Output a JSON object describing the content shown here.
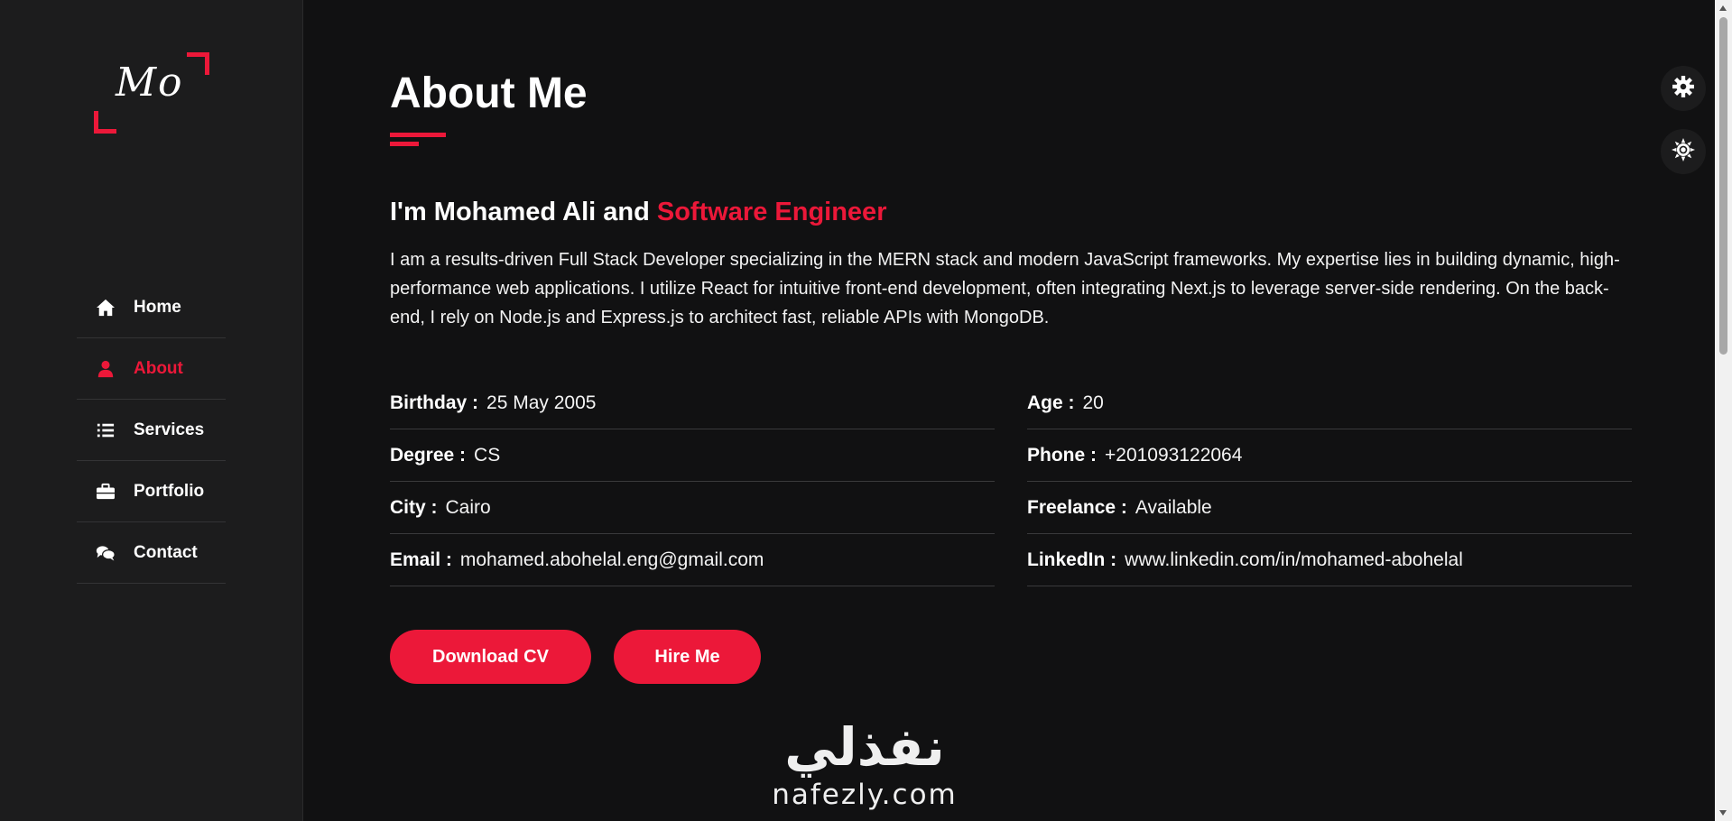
{
  "logo": {
    "text": "Mo"
  },
  "nav": [
    {
      "label": "Home",
      "icon": "home-icon"
    },
    {
      "label": "About",
      "icon": "user-icon",
      "active": true
    },
    {
      "label": "Services",
      "icon": "list-icon"
    },
    {
      "label": "Portfolio",
      "icon": "briefcase-icon"
    },
    {
      "label": "Contact",
      "icon": "comments-icon"
    }
  ],
  "about": {
    "title": "About Me",
    "intro_prefix": "I'm Mohamed Ali and ",
    "intro_role": "Software Engineer",
    "bio": "I am a results-driven Full Stack Developer specializing in the MERN stack and modern JavaScript frameworks. My expertise lies in building dynamic, high-performance web applications. I utilize React for intuitive front-end development, often integrating Next.js to leverage server-side rendering. On the back-end, I rely on Node.js and Express.js to architect fast, reliable APIs with MongoDB.",
    "info_left": [
      {
        "label": "Birthday :",
        "value": "25 May 2005"
      },
      {
        "label": "Degree :",
        "value": "CS"
      },
      {
        "label": "City :",
        "value": "Cairo"
      },
      {
        "label": "Email :",
        "value": "mohamed.abohelal.eng@gmail.com"
      }
    ],
    "info_right": [
      {
        "label": "Age :",
        "value": "20"
      },
      {
        "label": "Phone :",
        "value": "+201093122064"
      },
      {
        "label": "Freelance :",
        "value": "Available"
      },
      {
        "label": "LinkedIn :",
        "value": "www.linkedin.com/in/mohamed-abohelal"
      }
    ],
    "buttons": {
      "download_cv": "Download CV",
      "hire_me": "Hire Me"
    }
  },
  "watermark": {
    "arabic": "نفذلي",
    "latin": "nafezly.com"
  },
  "colors": {
    "accent": "#ec1839",
    "background": "#111112",
    "sidebar": "#1c1c1d"
  },
  "toolbar": {
    "settings_icon": "gear-icon",
    "theme_icon": "sun-icon"
  }
}
